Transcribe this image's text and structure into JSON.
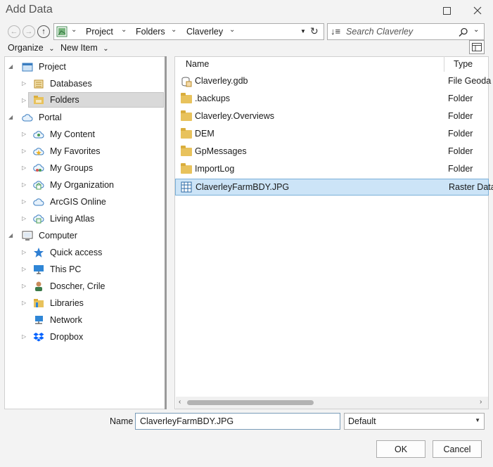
{
  "window": {
    "title": "Add Data"
  },
  "address": {
    "crumbs": [
      "Project",
      "Folders",
      "Claverley"
    ]
  },
  "search": {
    "placeholder": "Search Claverley"
  },
  "toolbar": {
    "organize_label": "Organize",
    "new_item_label": "New Item"
  },
  "tree": {
    "project": {
      "label": "Project",
      "children": [
        "Databases",
        "Folders"
      ]
    },
    "portal": {
      "label": "Portal",
      "children": [
        "My Content",
        "My Favorites",
        "My Groups",
        "My Organization",
        "ArcGIS Online",
        "Living Atlas"
      ]
    },
    "computer": {
      "label": "Computer",
      "children": [
        "Quick access",
        "This PC",
        "Doscher, Crile",
        "Libraries",
        "Network",
        "Dropbox"
      ]
    },
    "selected": "Folders"
  },
  "files": {
    "columns": [
      "Name",
      "Type"
    ],
    "rows": [
      {
        "name": "Claverley.gdb",
        "type": "File Geoda",
        "icon": "geodatabase-icon"
      },
      {
        "name": ".backups",
        "type": "Folder",
        "icon": "folder-icon"
      },
      {
        "name": "Claverley.Overviews",
        "type": "Folder",
        "icon": "folder-icon"
      },
      {
        "name": "DEM",
        "type": "Folder",
        "icon": "folder-icon"
      },
      {
        "name": "GpMessages",
        "type": "Folder",
        "icon": "folder-icon"
      },
      {
        "name": "ImportLog",
        "type": "Folder",
        "icon": "folder-icon"
      },
      {
        "name": "ClaverleyFarmBDY.JPG",
        "type": "Raster Data",
        "icon": "raster-icon"
      }
    ],
    "selected": "ClaverleyFarmBDY.JPG"
  },
  "bottom": {
    "name_label": "Name",
    "name_value": "ClaverleyFarmBDY.JPG",
    "filter_value": "Default",
    "ok_label": "OK",
    "cancel_label": "Cancel"
  },
  "colors": {
    "selection_blue": "#cce4f7",
    "tree_selection": "#d9d9d9",
    "folder_yellow": "#e8c25c"
  }
}
